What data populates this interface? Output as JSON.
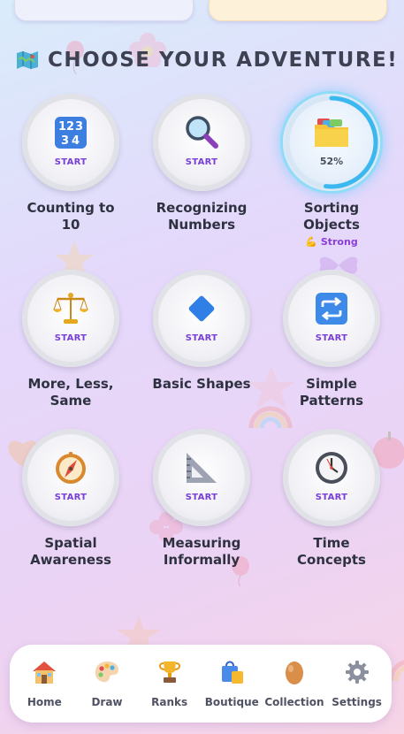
{
  "section": {
    "title": "CHOOSE YOUR ADVENTURE!",
    "icon": "map-icon"
  },
  "tiles": [
    {
      "name": "Counting to 10",
      "name_line1": "Counting to",
      "name_line2": "10",
      "action": "START",
      "icon": "numbers-icon"
    },
    {
      "name": "Recognizing Numbers",
      "name_line1": "Recognizing",
      "name_line2": "Numbers",
      "action": "START",
      "icon": "magnifier-icon"
    },
    {
      "name": "Sorting Objects",
      "name_line1": "Sorting",
      "name_line2": "Objects",
      "progress_label": "52%",
      "progress": 0.52,
      "badge": "💪 Strong",
      "icon": "folder-icon"
    },
    {
      "name": "More, Less, Same",
      "name_line1": "More, Less,",
      "name_line2": "Same",
      "action": "START",
      "icon": "scales-icon"
    },
    {
      "name": "Basic Shapes",
      "name_line1": "Basic Shapes",
      "name_line2": "",
      "action": "START",
      "icon": "diamond-icon"
    },
    {
      "name": "Simple Patterns",
      "name_line1": "Simple",
      "name_line2": "Patterns",
      "action": "START",
      "icon": "repeat-icon"
    },
    {
      "name": "Spatial Awareness",
      "name_line1": "Spatial",
      "name_line2": "Awareness",
      "action": "START",
      "icon": "compass-icon"
    },
    {
      "name": "Measuring Informally",
      "name_line1": "Measuring",
      "name_line2": "Informally",
      "action": "START",
      "icon": "ruler-icon"
    },
    {
      "name": "Time Concepts",
      "name_line1": "Time",
      "name_line2": "Concepts",
      "action": "START",
      "icon": "clock-icon"
    }
  ],
  "nav": [
    {
      "label": "Home",
      "icon": "house-icon"
    },
    {
      "label": "Draw",
      "icon": "palette-icon"
    },
    {
      "label": "Ranks",
      "icon": "trophy-icon"
    },
    {
      "label": "Boutique",
      "icon": "shopping-bags-icon"
    },
    {
      "label": "Collection",
      "icon": "egg-icon"
    },
    {
      "label": "Settings",
      "icon": "gear-icon"
    }
  ],
  "colors": {
    "accent": "#7a3fd6",
    "progress_ring": "#3bb8ef",
    "title": "#3e4152"
  }
}
